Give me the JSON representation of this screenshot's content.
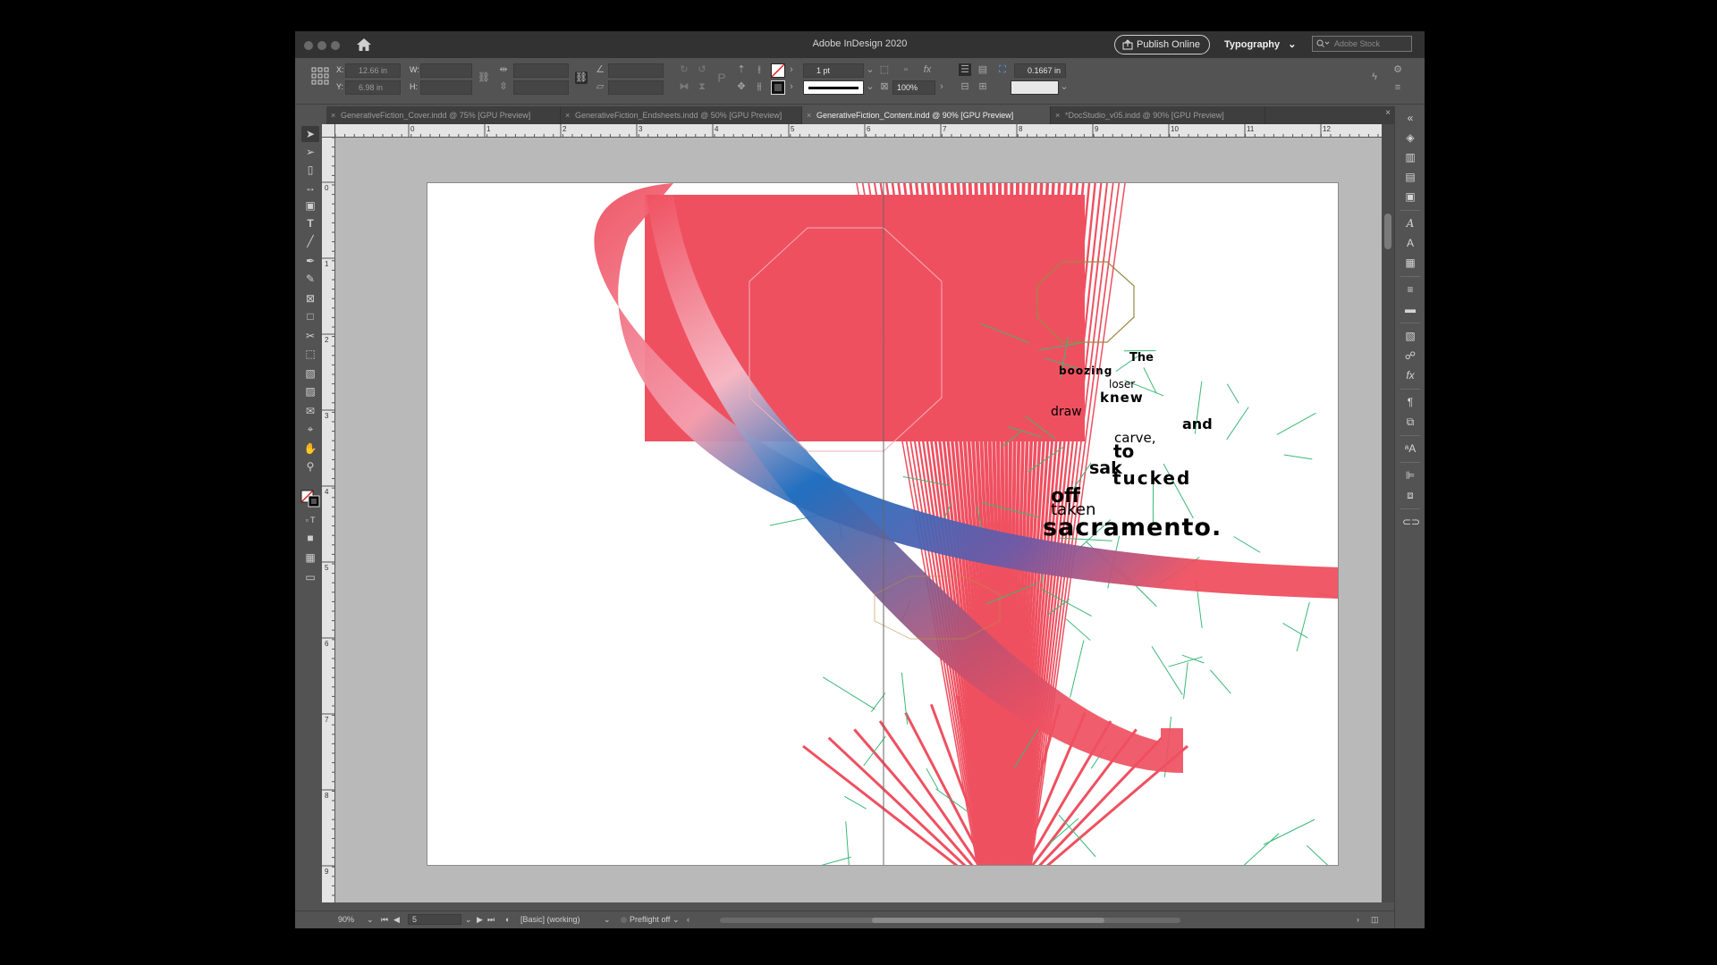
{
  "app": {
    "title": "Adobe InDesign 2020",
    "publish_label": "Publish Online",
    "workspace": "Typography",
    "stock_placeholder": "Adobe Stock"
  },
  "control": {
    "x_label": "X:",
    "x_value": "12.66 in",
    "y_label": "Y:",
    "y_value": "6.98 in",
    "w_label": "W:",
    "h_label": "H:",
    "stroke_weight": "1 pt",
    "opacity": "100%",
    "inset": "0.1667 in"
  },
  "tabs": [
    {
      "label": "GenerativeFiction_Cover.indd @ 75% [GPU Preview]"
    },
    {
      "label": "GenerativeFiction_Endsheets.indd @ 50% [GPU Preview]"
    },
    {
      "label": "GenerativeFiction_Content.indd @ 90% [GPU Preview]"
    },
    {
      "label": "*DocStudio_v05.indd @ 90% [GPU Preview]"
    }
  ],
  "ruler": {
    "h_ticks": [
      "0",
      "1",
      "2",
      "3",
      "4",
      "5",
      "6",
      "7",
      "8",
      "9",
      "10",
      "11",
      "12"
    ],
    "v_ticks": [
      "0",
      "1",
      "2",
      "3",
      "4",
      "5",
      "6",
      "7",
      "8",
      "9"
    ]
  },
  "artwork": {
    "words": [
      "The",
      "boozing",
      "loser",
      "knew",
      "draw",
      "and",
      "carve,",
      "to",
      "sak",
      "tucked",
      "off",
      "taken",
      "sacramento."
    ]
  },
  "status": {
    "zoom": "90%",
    "page": "5",
    "profile": "[Basic] (working)",
    "preflight": "Preflight off"
  },
  "colors": {
    "accent_red": "#ef5060",
    "accent_blue": "#1f6fc0",
    "ui_dark": "#535353"
  }
}
